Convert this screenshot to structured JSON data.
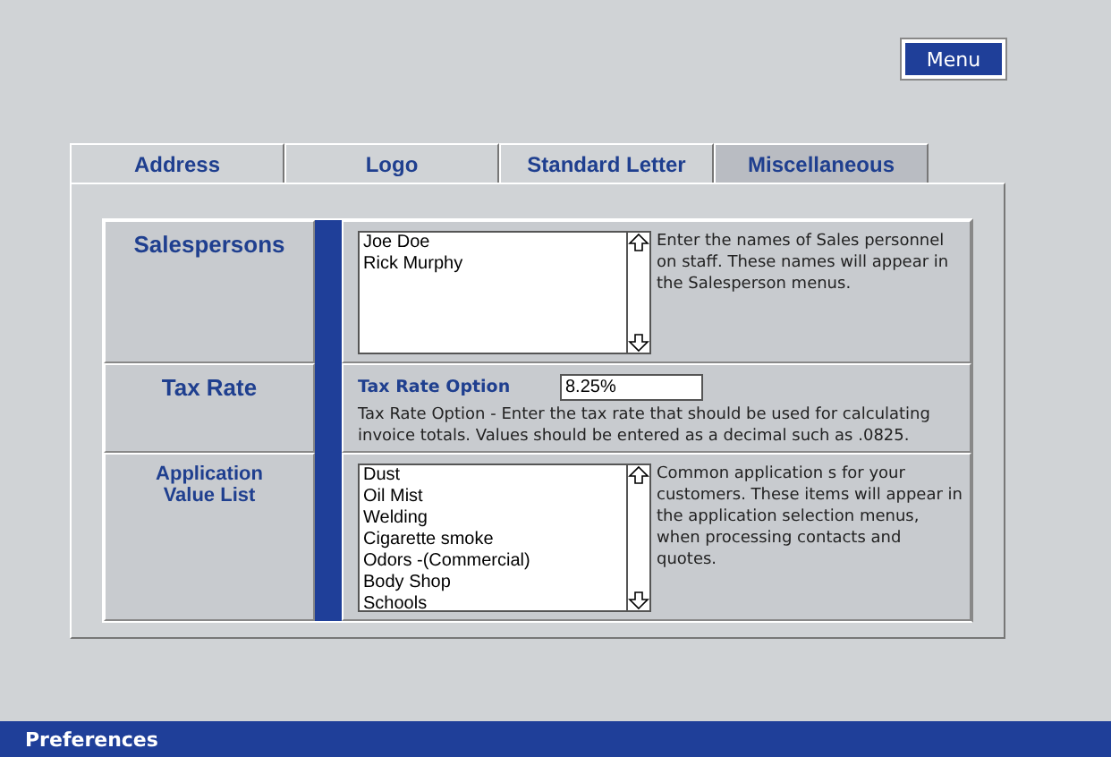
{
  "menu_button": "Menu",
  "tabs": [
    {
      "label": "Address",
      "selected": false
    },
    {
      "label": "Logo",
      "selected": false
    },
    {
      "label": "Standard Letter",
      "selected": false
    },
    {
      "label": "Miscellaneous",
      "selected": true
    }
  ],
  "sections": [
    {
      "kind": "list",
      "label": "Salespersons",
      "items": [
        "Joe Doe",
        "Rick Murphy"
      ],
      "help": "Enter the names of Sales personnel on staff.  These names will appear in the Salesperson menus."
    },
    {
      "kind": "field",
      "label": "Tax Rate",
      "field_label": "Tax Rate Option",
      "value": "8.25%",
      "help": "Tax Rate Option - Enter the tax rate that should be used for calculating invoice totals.  Values should be entered as a decimal such as .0825."
    },
    {
      "kind": "list",
      "label": "Application Value List",
      "items": [
        "Dust",
        "Oil Mist",
        "Welding",
        "Cigarette smoke",
        "Odors -(Commercial)",
        "Body Shop",
        "Schools"
      ],
      "help": "Common application s for your customers.  These items will appear in the application selection menus, when processing contacts and quotes."
    }
  ],
  "status_bar": {
    "title": "Preferences"
  }
}
